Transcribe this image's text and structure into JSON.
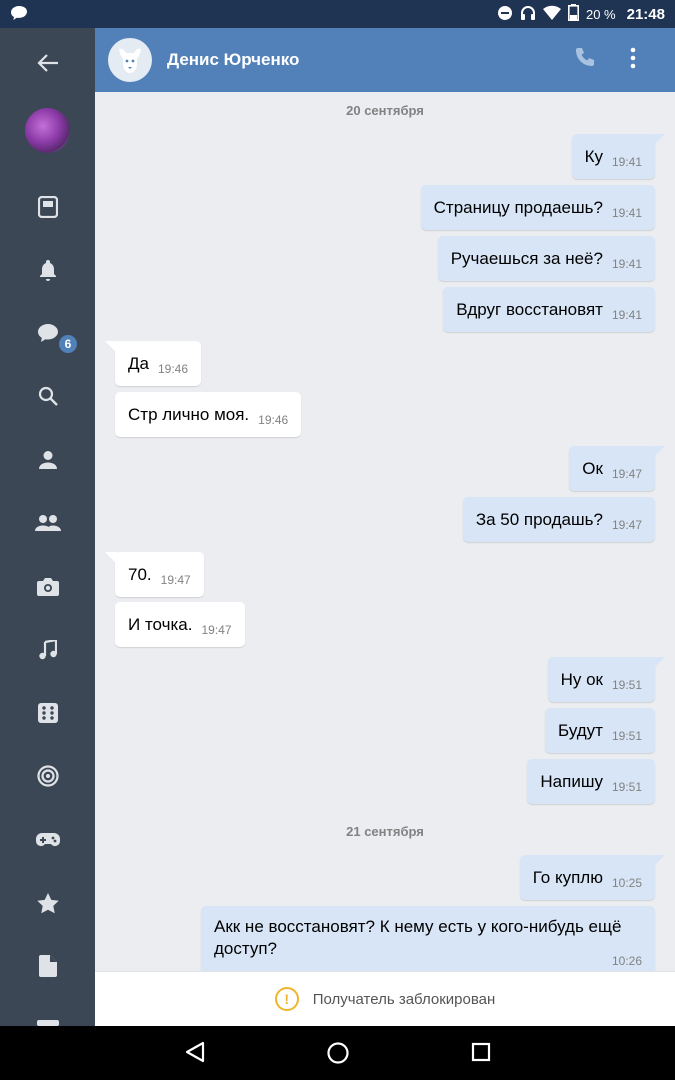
{
  "status_bar": {
    "battery_pct": "20 %",
    "time": "21:48"
  },
  "sidebar": {
    "badge_count": "6",
    "items": [
      "back-icon",
      "avatar",
      "news-icon",
      "bell-icon",
      "messages-icon",
      "search-icon",
      "profile-icon",
      "friends-icon",
      "camera-icon",
      "music-icon",
      "apps-icon",
      "target-icon",
      "games-icon",
      "star-icon",
      "document-icon",
      "more-icon"
    ]
  },
  "header": {
    "contact_name": "Денис Юрченко"
  },
  "chat": {
    "date1": "20 сентября",
    "date2": "21 сентября",
    "messages": [
      {
        "dir": "out",
        "text": "Ку",
        "time": "19:41"
      },
      {
        "dir": "out",
        "text": "Страницу продаешь?",
        "time": "19:41"
      },
      {
        "dir": "out",
        "text": "Ручаешься за неё?",
        "time": "19:41"
      },
      {
        "dir": "out",
        "text": "Вдруг восстановят",
        "time": "19:41"
      },
      {
        "dir": "in",
        "text": "Да",
        "time": "19:46"
      },
      {
        "dir": "in",
        "text": "Стр лично моя.",
        "time": "19:46"
      },
      {
        "dir": "out",
        "text": "Ок",
        "time": "19:47"
      },
      {
        "dir": "out",
        "text": "За 50 продашь?",
        "time": "19:47"
      },
      {
        "dir": "in",
        "text": "70.",
        "time": "19:47"
      },
      {
        "dir": "in",
        "text": "И точка.",
        "time": "19:47"
      },
      {
        "dir": "out",
        "text": "Ну ок",
        "time": "19:51"
      },
      {
        "dir": "out",
        "text": "Будут",
        "time": "19:51"
      },
      {
        "dir": "out",
        "text": "Напишу",
        "time": "19:51"
      },
      {
        "dir": "out",
        "text": "Го куплю",
        "time": "10:25"
      },
      {
        "dir": "out",
        "text": "Акк не восстановят? К нему есть у кого-нибудь ещё доступ?",
        "time": "10:26"
      }
    ]
  },
  "footer": {
    "blocked_text": "Получатель заблокирован"
  }
}
